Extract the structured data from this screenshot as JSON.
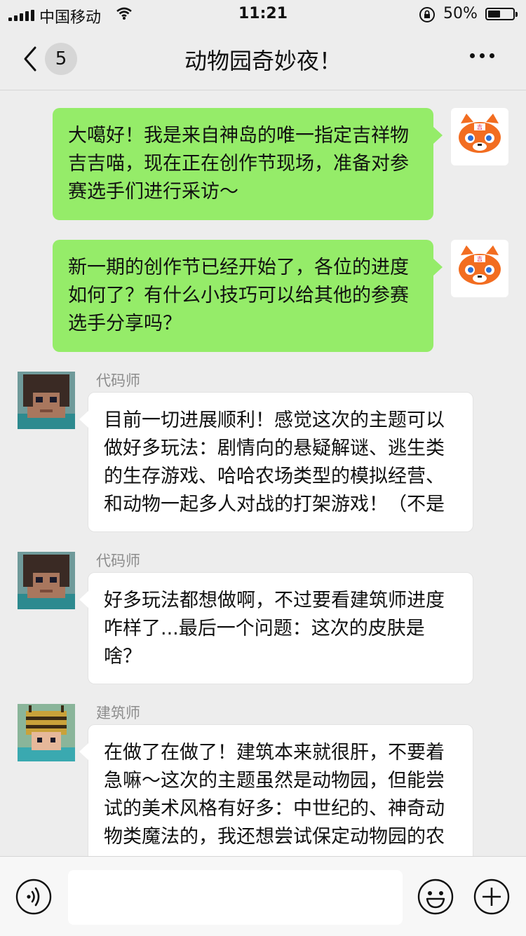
{
  "status": {
    "carrier": "中国移动",
    "time": "11:21",
    "battery": "50%",
    "battery_level": 0.5
  },
  "nav": {
    "unread_count": "5",
    "title": "动物园奇妙夜！"
  },
  "messages": [
    {
      "side": "out",
      "text": "大噶好！我是来自神岛的唯一指定吉祥物吉吉喵，现在正在创作节现场，准备对参赛选手们进行采访～",
      "avatar_icon": "tiger-mascot-icon"
    },
    {
      "side": "out",
      "text": "新一期的创作节已经开始了，各位的进度如何了？有什么小技巧可以给其他的参赛选手分享吗？",
      "avatar_icon": "tiger-mascot-icon"
    },
    {
      "side": "in",
      "sender": "代码师",
      "text": "目前一切进展顺利！感觉这次的主题可以做好多玩法：剧情向的悬疑解谜、逃生类的生存游戏、哈哈农场类型的模拟经营、和动物一起多人对战的打架游戏！（不是",
      "avatar_icon": "coder-avatar-icon"
    },
    {
      "side": "in",
      "sender": "代码师",
      "text": "好多玩法都想做啊，不过要看建筑师进度咋样了...最后一个问题：这次的皮肤是啥？",
      "avatar_icon": "coder-avatar-icon"
    },
    {
      "side": "in",
      "sender": "建筑师",
      "text": "在做了在做了！建筑本来就很肝，不要着急嘛～这次的主题虽然是动物园，但能尝试的美术风格有好多：中世纪的、神奇动物类魔法的，我还想尝试保定动物园的农",
      "avatar_icon": "builder-bee-avatar-icon"
    }
  ],
  "toolbar": {
    "input_value": "",
    "voice_icon": "voice-icon",
    "emoji_icon": "emoji-icon",
    "plus_icon": "plus-icon"
  },
  "colors": {
    "background": "#ededed",
    "outgoing_bubble": "#95ec69",
    "incoming_bubble": "#ffffff",
    "sender_name": "#8d8d8d"
  }
}
